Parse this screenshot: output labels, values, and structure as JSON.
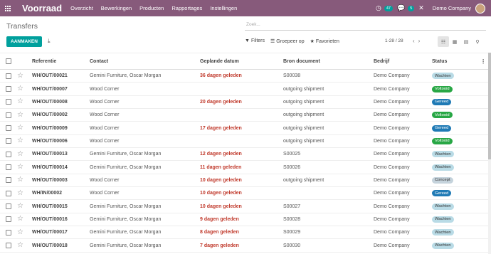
{
  "navbar": {
    "app_title": "Voorraad",
    "menu": [
      "Overzicht",
      "Bewerkingen",
      "Producten",
      "Rapportages",
      "Instellingen"
    ],
    "activity_badge": "47",
    "messages_badge": "5",
    "company": "Demo Company"
  },
  "control": {
    "breadcrumb": "Transfers",
    "search_placeholder": "Zoek...",
    "create_label": "AANMAKEN",
    "filters_label": "Filters",
    "groupby_label": "Groepeer op",
    "favorites_label": "Favorieten",
    "pager": "1-28 / 28"
  },
  "table": {
    "headers": {
      "ref": "Referentie",
      "contact": "Contact",
      "date": "Geplande datum",
      "source": "Bron document",
      "company": "Bedrijf",
      "status": "Status"
    },
    "rows": [
      {
        "ref": "WH/OUT/00021",
        "contact": "Gemini Furniture, Oscar Morgan",
        "date": "36 dagen geleden",
        "source": "S00038",
        "company": "Demo Company",
        "status": "Wachten"
      },
      {
        "ref": "WH/OUT/00007",
        "contact": "Wood Corner",
        "date": "",
        "source": "outgoing shipment",
        "company": "Demo Company",
        "status": "Voltooid"
      },
      {
        "ref": "WH/OUT/00008",
        "contact": "Wood Corner",
        "date": "20 dagen geleden",
        "source": "outgoing shipment",
        "company": "Demo Company",
        "status": "Gereed"
      },
      {
        "ref": "WH/OUT/00002",
        "contact": "Wood Corner",
        "date": "",
        "source": "outgoing shipment",
        "company": "Demo Company",
        "status": "Voltooid"
      },
      {
        "ref": "WH/OUT/00009",
        "contact": "Wood Corner",
        "date": "17 dagen geleden",
        "source": "outgoing shipment",
        "company": "Demo Company",
        "status": "Gereed"
      },
      {
        "ref": "WH/OUT/00006",
        "contact": "Wood Corner",
        "date": "",
        "source": "outgoing shipment",
        "company": "Demo Company",
        "status": "Voltooid"
      },
      {
        "ref": "WH/OUT/00013",
        "contact": "Gemini Furniture, Oscar Morgan",
        "date": "12 dagen geleden",
        "source": "S00025",
        "company": "Demo Company",
        "status": "Wachten"
      },
      {
        "ref": "WH/OUT/00014",
        "contact": "Gemini Furniture, Oscar Morgan",
        "date": "11 dagen geleden",
        "source": "S00026",
        "company": "Demo Company",
        "status": "Wachten"
      },
      {
        "ref": "WH/OUT/00003",
        "contact": "Wood Corner",
        "date": "10 dagen geleden",
        "source": "outgoing shipment",
        "company": "Demo Company",
        "status": "Concept"
      },
      {
        "ref": "WH/IN/00002",
        "contact": "Wood Corner",
        "date": "10 dagen geleden",
        "source": "",
        "company": "Demo Company",
        "status": "Gereed"
      },
      {
        "ref": "WH/OUT/00015",
        "contact": "Gemini Furniture, Oscar Morgan",
        "date": "10 dagen geleden",
        "source": "S00027",
        "company": "Demo Company",
        "status": "Wachten"
      },
      {
        "ref": "WH/OUT/00016",
        "contact": "Gemini Furniture, Oscar Morgan",
        "date": "9 dagen geleden",
        "source": "S00028",
        "company": "Demo Company",
        "status": "Wachten"
      },
      {
        "ref": "WH/OUT/00017",
        "contact": "Gemini Furniture, Oscar Morgan",
        "date": "8 dagen geleden",
        "source": "S00029",
        "company": "Demo Company",
        "status": "Wachten"
      },
      {
        "ref": "WH/OUT/00018",
        "contact": "Gemini Furniture, Oscar Morgan",
        "date": "7 dagen geleden",
        "source": "S00030",
        "company": "Demo Company",
        "status": "Wachten"
      }
    ]
  },
  "colors": {
    "brand": "#875a7b",
    "primary_button": "#00a09d",
    "late_date": "#c0392b"
  }
}
